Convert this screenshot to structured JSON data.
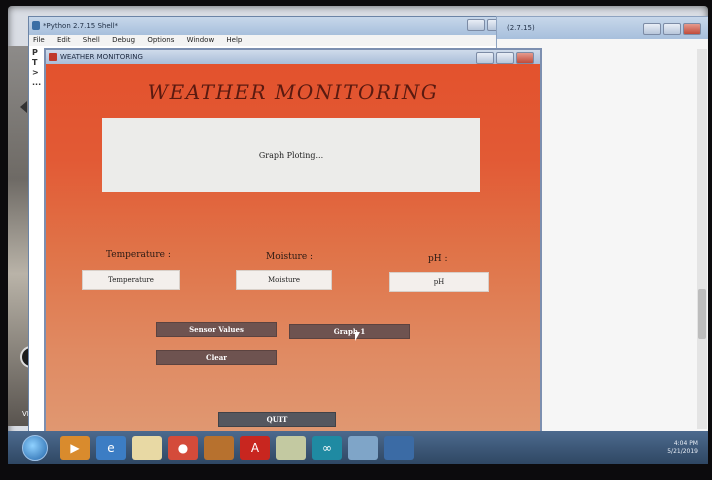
{
  "shell": {
    "title": "*Python 2.7.15 Shell*",
    "menu": [
      "File",
      "Edit",
      "Shell",
      "Debug",
      "Options",
      "Window",
      "Help"
    ],
    "body_lines": [
      "P",
      "T",
      ">",
      "..."
    ]
  },
  "shell2": {
    "title": "(2.7.15)"
  },
  "desktop": {
    "vnc_label": "VNC"
  },
  "weather_window": {
    "title": "WEATHER MONITORING",
    "heading": "WEATHER MONITORING",
    "graph_placeholder": "Graph Ploting...",
    "labels": {
      "temperature": "Temperature :",
      "moisture": "Moisture :",
      "ph": "pH :"
    },
    "fields": {
      "temperature": "Temperature",
      "moisture": "Moisture",
      "ph": "pH"
    },
    "buttons": {
      "sensor_values": "Sensor Values",
      "graph": "Graph 1",
      "clear": "Clear",
      "quit": "QUIT"
    }
  },
  "taskbar": {
    "icons": [
      "media-player-icon",
      "ie-icon",
      "folder-icon",
      "chrome-icon",
      "app-icon",
      "acrobat-icon",
      "explorer-icon",
      "arduino-icon",
      "app2-icon",
      "python-icon"
    ],
    "clock_time": "4:04 PM",
    "clock_date": "5/21/2019"
  },
  "colors": {
    "form_top": "#e3522d",
    "form_bottom": "#e09a74",
    "button": "#6e5350",
    "quit_button": "#55575f"
  }
}
